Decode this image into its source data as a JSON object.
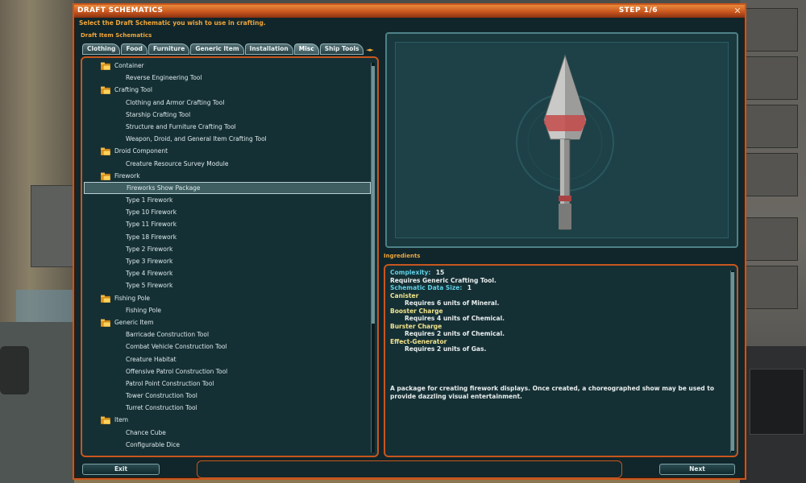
{
  "window": {
    "title": "DRAFT SCHEMATICS",
    "step": "STEP 1/6",
    "close_glyph": "✕",
    "subtitle": "Select the Draft Schematic you wish to use in crafting."
  },
  "schematics": {
    "section_label": "Draft Item Schematics",
    "tabs": [
      {
        "label": "Clothing"
      },
      {
        "label": "Food"
      },
      {
        "label": "Furniture"
      },
      {
        "label": "Generic Item"
      },
      {
        "label": "Installation"
      },
      {
        "label": "Misc"
      },
      {
        "label": "Ship Tools"
      }
    ],
    "tab_arrows": "◄►",
    "tree": [
      {
        "type": "cat",
        "label": "Container"
      },
      {
        "type": "item",
        "label": "Reverse Engineering Tool"
      },
      {
        "type": "cat",
        "label": "Crafting Tool"
      },
      {
        "type": "item",
        "label": "Clothing and Armor Crafting Tool"
      },
      {
        "type": "item",
        "label": "Starship Crafting Tool"
      },
      {
        "type": "item",
        "label": "Structure and Furniture Crafting Tool"
      },
      {
        "type": "item",
        "label": "Weapon, Droid, and General Item Crafting Tool"
      },
      {
        "type": "cat",
        "label": "Droid Component"
      },
      {
        "type": "item",
        "label": "Creature Resource Survey Module"
      },
      {
        "type": "cat",
        "label": "Firework"
      },
      {
        "type": "item",
        "label": "Fireworks Show Package",
        "selected": true
      },
      {
        "type": "item",
        "label": "Type 1 Firework"
      },
      {
        "type": "item",
        "label": "Type 10 Firework"
      },
      {
        "type": "item",
        "label": "Type 11 Firework"
      },
      {
        "type": "item",
        "label": "Type 18 Firework"
      },
      {
        "type": "item",
        "label": "Type 2 Firework"
      },
      {
        "type": "item",
        "label": "Type 3 Firework"
      },
      {
        "type": "item",
        "label": "Type 4 Firework"
      },
      {
        "type": "item",
        "label": "Type 5 Firework"
      },
      {
        "type": "cat",
        "label": "Fishing Pole"
      },
      {
        "type": "item",
        "label": "Fishing Pole"
      },
      {
        "type": "cat",
        "label": "Generic Item"
      },
      {
        "type": "item",
        "label": "Barricade Construction Tool"
      },
      {
        "type": "item",
        "label": "Combat Vehicle Construction Tool"
      },
      {
        "type": "item",
        "label": "Creature Habitat"
      },
      {
        "type": "item",
        "label": "Offensive Patrol Construction Tool"
      },
      {
        "type": "item",
        "label": "Patrol Point Construction Tool"
      },
      {
        "type": "item",
        "label": "Tower Construction Tool"
      },
      {
        "type": "item",
        "label": "Turret Construction Tool"
      },
      {
        "type": "cat",
        "label": "Item"
      },
      {
        "type": "item",
        "label": "Chance Cube"
      },
      {
        "type": "item",
        "label": "Configurable Dice"
      }
    ]
  },
  "ingredients": {
    "section_label": "Ingredients",
    "complexity_key": "Complexity:",
    "complexity_value": "15",
    "requires_tool": "Requires Generic Crafting Tool.",
    "data_size_key": "Schematic Data Size:",
    "data_size_value": "1",
    "components": [
      {
        "name": "Canister",
        "requirement": "Requires 6 units of Mineral."
      },
      {
        "name": "Booster Charge",
        "requirement": "Requires 4 units of Chemical."
      },
      {
        "name": "Burster Charge",
        "requirement": "Requires 2 units of Chemical."
      },
      {
        "name": "Effect-Generator",
        "requirement": "Requires 2 units of Gas."
      }
    ],
    "description": "A package for creating firework displays. Once created, a choreographed show may be used to provide dazzling visual entertainment."
  },
  "footer": {
    "exit_label": "Exit",
    "next_label": "Next"
  },
  "colors": {
    "accent": "#c8561e",
    "highlight": "#f0a53a",
    "panel": "#153035"
  }
}
